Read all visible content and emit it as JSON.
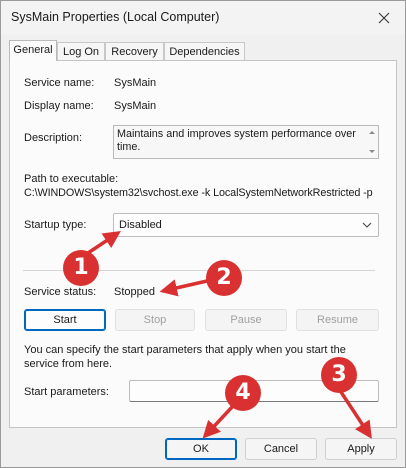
{
  "window": {
    "title": "SysMain Properties (Local Computer)"
  },
  "tabs": [
    {
      "label": "General",
      "active": true
    },
    {
      "label": "Log On",
      "active": false
    },
    {
      "label": "Recovery",
      "active": false
    },
    {
      "label": "Dependencies",
      "active": false
    }
  ],
  "general": {
    "service_name_label": "Service name:",
    "service_name": "SysMain",
    "display_name_label": "Display name:",
    "display_name": "SysMain",
    "description_label": "Description:",
    "description": "Maintains and improves system performance over time.",
    "path_label": "Path to executable:",
    "path": "C:\\WINDOWS\\system32\\svchost.exe -k LocalSystemNetworkRestricted -p",
    "startup_type_label": "Startup type:",
    "startup_type": "Disabled",
    "status_label": "Service status:",
    "status": "Stopped",
    "buttons": {
      "start": "Start",
      "stop": "Stop",
      "pause": "Pause",
      "resume": "Resume"
    },
    "help_text": "You can specify the start parameters that apply when you start the service from here.",
    "start_params_label": "Start parameters:",
    "start_params_value": ""
  },
  "footer": {
    "ok": "OK",
    "cancel": "Cancel",
    "apply": "Apply"
  },
  "callouts": [
    "1",
    "2",
    "3",
    "4"
  ],
  "colors": {
    "callout": "#d93131",
    "accent": "#0067c0"
  },
  "icons": {
    "close": "close-icon",
    "dropdown": "chevron-down-icon"
  }
}
